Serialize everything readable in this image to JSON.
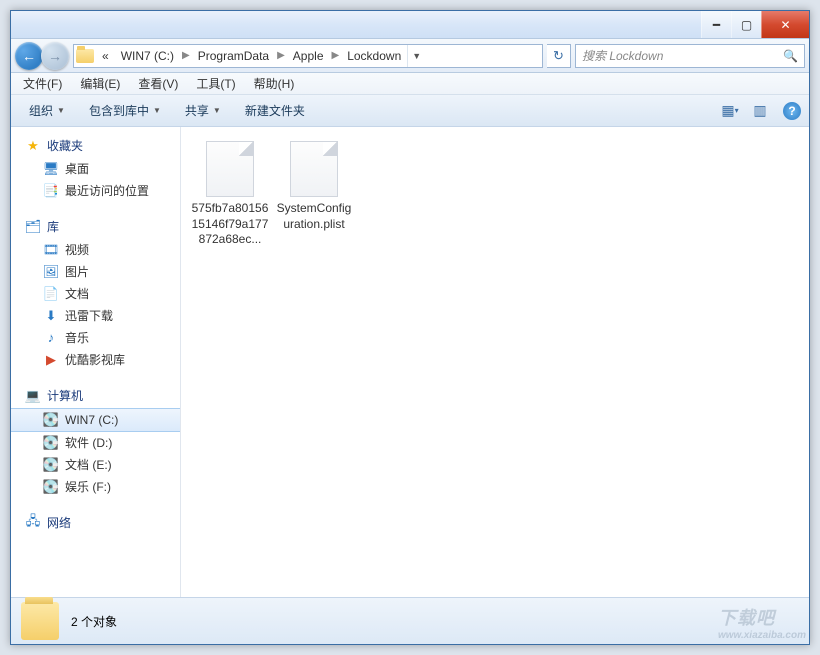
{
  "breadcrumbs": [
    "WIN7 (C:)",
    "ProgramData",
    "Apple",
    "Lockdown"
  ],
  "crumb_prefix": "«",
  "search_placeholder": "搜索 Lockdown",
  "menu": {
    "file": "文件(F)",
    "edit": "编辑(E)",
    "view": "查看(V)",
    "tools": "工具(T)",
    "help": "帮助(H)"
  },
  "toolbar": {
    "organize": "组织",
    "include": "包含到库中",
    "share": "共享",
    "newfolder": "新建文件夹"
  },
  "sidebar": {
    "favorites": {
      "label": "收藏夹",
      "items": [
        "桌面",
        "最近访问的位置"
      ]
    },
    "libraries": {
      "label": "库",
      "items": [
        "视频",
        "图片",
        "文档",
        "迅雷下载",
        "音乐",
        "优酷影视库"
      ]
    },
    "computer": {
      "label": "计算机",
      "items": [
        "WIN7 (C:)",
        "软件 (D:)",
        "文档 (E:)",
        "娱乐 (F:)"
      ]
    },
    "network": {
      "label": "网络"
    }
  },
  "files": [
    {
      "name": "575fb7a8015615146f79a177872a68ec..."
    },
    {
      "name": "SystemConfiguration.plist"
    }
  ],
  "status": {
    "count_label": "2 个对象"
  },
  "watermark": {
    "big": "下载吧",
    "small": "www.xiazaiba.com"
  }
}
